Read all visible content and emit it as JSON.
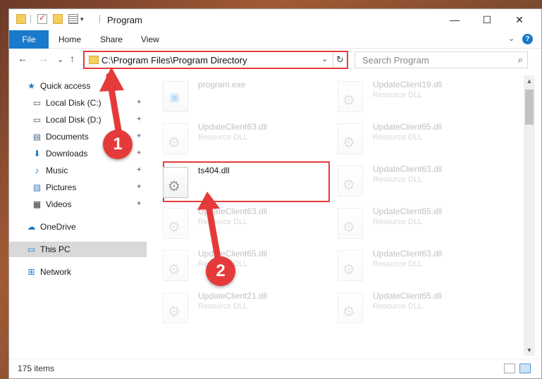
{
  "window": {
    "title": "Program",
    "minimize": "—",
    "maximize": "☐",
    "close": "✕"
  },
  "ribbon": {
    "tabs": [
      "File",
      "Home",
      "Share",
      "View"
    ],
    "collapse": "⌄",
    "help": "?"
  },
  "nav": {
    "back": "←",
    "forward": "→",
    "recent": "⌄",
    "up": "↑",
    "address": "C:\\Program Files\\Program Directory",
    "address_dropdown": "⌄",
    "refresh": "↻",
    "search_placeholder": "Search Program",
    "search_icon": "⌕"
  },
  "sidebar": {
    "items": [
      {
        "label": "Quick access",
        "icon": "★",
        "icon_color": "#1979ca",
        "pinned": false
      },
      {
        "label": "Local Disk (C:)",
        "icon": "▭",
        "icon_color": "#555",
        "pinned": true
      },
      {
        "label": "Local Disk (D:)",
        "icon": "▭",
        "icon_color": "#555",
        "pinned": true
      },
      {
        "label": "Documents",
        "icon": "▤",
        "icon_color": "#4a6a8a",
        "pinned": true
      },
      {
        "label": "Downloads",
        "icon": "⬇",
        "icon_color": "#1979ca",
        "pinned": true
      },
      {
        "label": "Music",
        "icon": "♪",
        "icon_color": "#1979ca",
        "pinned": true
      },
      {
        "label": "Pictures",
        "icon": "▨",
        "icon_color": "#3d7ab8",
        "pinned": true
      },
      {
        "label": "Videos",
        "icon": "▦",
        "icon_color": "#333",
        "pinned": true
      },
      {
        "label": "OneDrive",
        "icon": "☁",
        "icon_color": "#1979ca",
        "pinned": false
      },
      {
        "label": "This PC",
        "icon": "▭",
        "icon_color": "#1979ca",
        "pinned": false,
        "selected": true
      },
      {
        "label": "Network",
        "icon": "⊞",
        "icon_color": "#1979ca",
        "pinned": false
      }
    ],
    "pin_glyph": "📌"
  },
  "files": {
    "column_left": [
      {
        "name": "program.exe",
        "desc": "",
        "type": "exe",
        "faded": true
      },
      {
        "name": "UpdateClient63.dll",
        "desc": "Resource DLL",
        "faded": true
      },
      {
        "name": "ts404.dll",
        "desc": "",
        "faded": false
      },
      {
        "name": "UpdateClient63.dll",
        "desc": "Resource DLL",
        "faded": true
      },
      {
        "name": "UpdateClient65.dll",
        "desc": "Resource DLL",
        "faded": true
      },
      {
        "name": "UpdateClient21.dll",
        "desc": "Resource DLL",
        "faded": true
      }
    ],
    "column_right": [
      {
        "name": "UpdateClient19.dll",
        "desc": "Resource DLL",
        "faded": true
      },
      {
        "name": "UpdateClient65.dll",
        "desc": "Resource DLL",
        "faded": true
      },
      {
        "name": "UpdateClient63.dll",
        "desc": "Resource DLL",
        "faded": true
      },
      {
        "name": "UpdateClient65.dll",
        "desc": "Resource DLL",
        "faded": true
      },
      {
        "name": "UpdateClient63.dll",
        "desc": "Resource DLL",
        "faded": true
      },
      {
        "name": "UpdateClient65.dll",
        "desc": "Resource DLL",
        "faded": true
      }
    ]
  },
  "status": {
    "item_count": "175 items"
  },
  "annotations": {
    "step1": "1",
    "step2": "2",
    "color": "#e53a3a"
  }
}
